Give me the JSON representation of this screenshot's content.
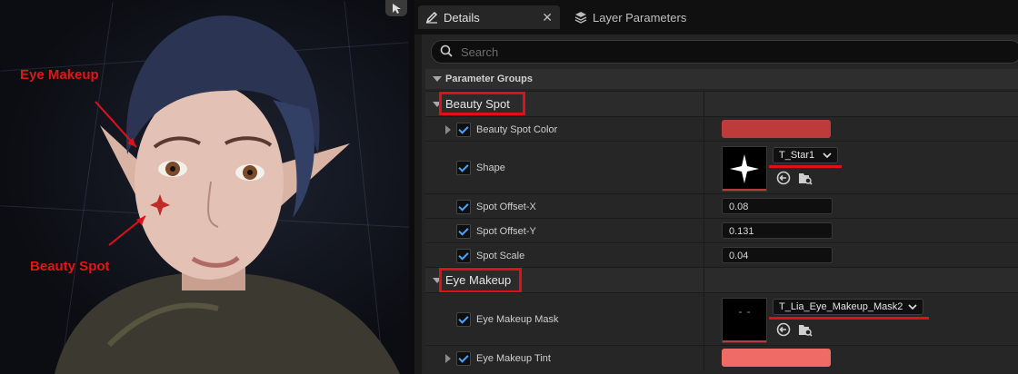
{
  "viewport": {
    "annotations": {
      "eye_makeup": "Eye Makeup",
      "beauty_spot": "Beauty Spot"
    }
  },
  "tabs": [
    {
      "label": "Details",
      "icon": "pencil-icon",
      "active": true
    },
    {
      "label": "Layer Parameters",
      "icon": "layers-icon",
      "active": false
    }
  ],
  "search": {
    "placeholder": "Search"
  },
  "parameter_groups_label": "Parameter Groups",
  "groups": {
    "beauty_spot": {
      "label": "Beauty Spot",
      "params": {
        "color": {
          "label": "Beauty Spot Color",
          "value": "#be3b3b"
        },
        "shape": {
          "label": "Shape",
          "texture": "T_Star1"
        },
        "offset_x": {
          "label": "Spot Offset-X",
          "value": "0.08"
        },
        "offset_y": {
          "label": "Spot Offset-Y",
          "value": "0.131"
        },
        "scale": {
          "label": "Spot Scale",
          "value": "0.04"
        }
      }
    },
    "eye_makeup": {
      "label": "Eye Makeup",
      "params": {
        "mask": {
          "label": "Eye Makeup Mask",
          "texture": "T_Lia_Eye_Makeup_Mask2"
        },
        "tint": {
          "label": "Eye Makeup Tint",
          "value": "#ee6b66"
        }
      }
    }
  },
  "colors": {
    "annotation": "#e0101a",
    "accent": "#4aa3ff"
  }
}
